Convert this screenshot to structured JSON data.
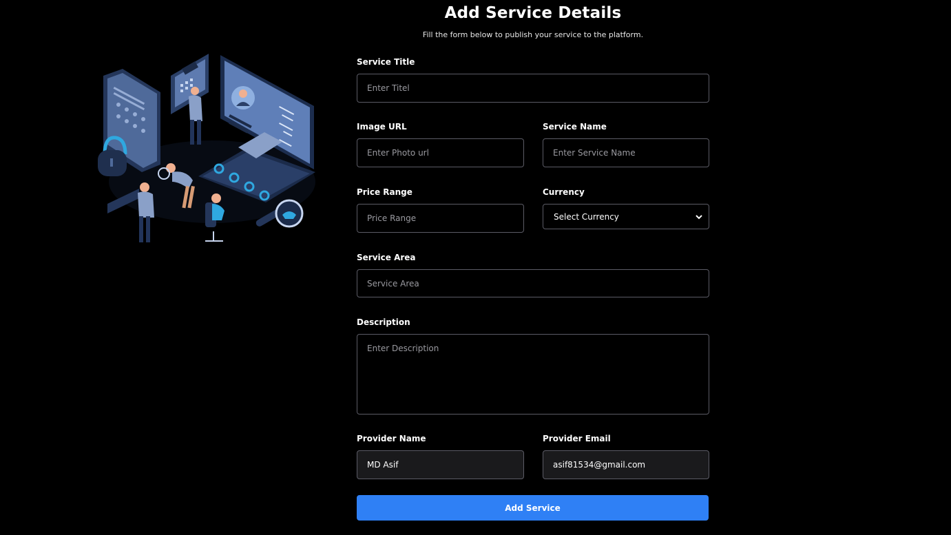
{
  "header": {
    "title": "Add Service Details",
    "subtitle": "Fill the form below to publish your service to the platform."
  },
  "form": {
    "service_title": {
      "label": "Service Title",
      "placeholder": "Enter Titel"
    },
    "image_url": {
      "label": "Image URL",
      "placeholder": "Enter Photo url"
    },
    "service_name": {
      "label": "Service Name",
      "placeholder": "Enter Service Name"
    },
    "price_range": {
      "label": "Price Range",
      "placeholder": "Price Range"
    },
    "currency": {
      "label": "Currency",
      "selected": "Select Currency"
    },
    "service_area": {
      "label": "Service Area",
      "placeholder": "Service Area"
    },
    "description": {
      "label": "Description",
      "placeholder": "Enter Description"
    },
    "provider_name": {
      "label": "Provider Name",
      "value": "MD Asif"
    },
    "provider_email": {
      "label": "Provider Email",
      "value": "asif81534@gmail.com"
    },
    "submit_label": "Add Service"
  },
  "colors": {
    "background": "#000000",
    "accent": "#2f80f5",
    "border": "#5c5c66",
    "illustration_primary": "#3a5080",
    "illustration_highlight": "#2fa8e0"
  },
  "icons": {
    "illustration": "data-security-team-illustration",
    "select_arrow": "chevron-down-icon"
  }
}
